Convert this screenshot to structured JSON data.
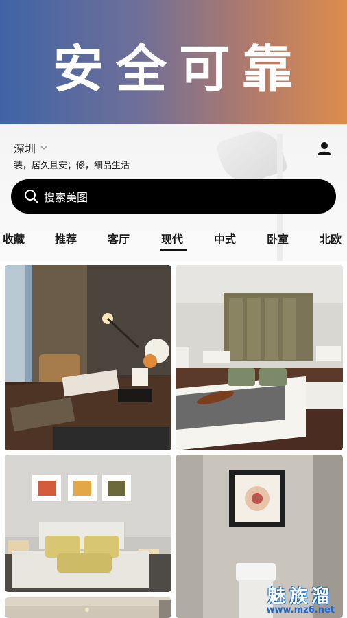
{
  "banner": {
    "title": "安全可靠"
  },
  "header": {
    "city": "深圳",
    "slogan": "装，居久且安；修，细品生活"
  },
  "search": {
    "placeholder": "搜索美图"
  },
  "tabs": [
    "收藏",
    "推荐",
    "客厅",
    "现代",
    "中式",
    "卧室",
    "北欧"
  ],
  "active_tab": "现代",
  "gallery": {
    "items": [
      {
        "subject": "study-room-desk-lamp"
      },
      {
        "subject": "bedroom-violin-bed"
      },
      {
        "subject": "bedroom-yellow-pillows"
      },
      {
        "subject": "bathroom-flower-painting"
      }
    ]
  },
  "watermark": {
    "main": "魅族溜",
    "url": "www.mz6.net"
  },
  "colors": {
    "accent": "#000000",
    "banner_left": "#3f64a6",
    "banner_right": "#dd8d4c"
  }
}
